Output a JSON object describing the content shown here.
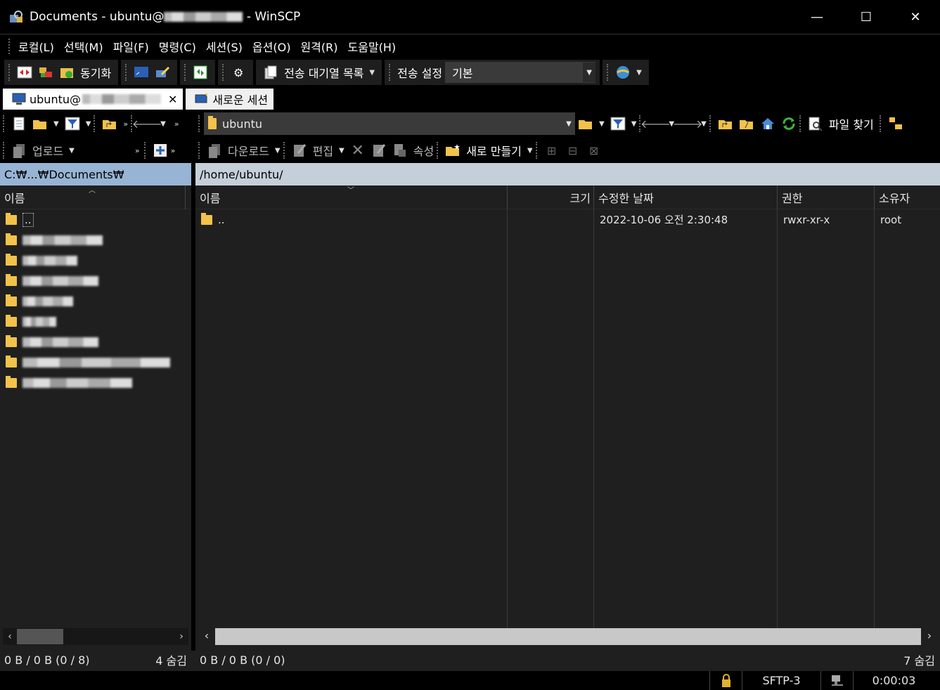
{
  "window": {
    "title_prefix": "Documents - ubuntu@",
    "title_suffix": " - WinSCP",
    "minimize": "—",
    "maximize": "☐",
    "close": "✕"
  },
  "menu": [
    "로컬(L)",
    "선택(M)",
    "파일(F)",
    "명령(C)",
    "세션(S)",
    "옵션(O)",
    "원격(R)",
    "도움말(H)"
  ],
  "toolbar": {
    "sync_label": "동기화",
    "queue_label": "전송 대기열 목록",
    "transfer_settings_label": "전송 설정",
    "transfer_preset_value": "기본"
  },
  "tabs": {
    "session_label": "ubuntu@",
    "new_session_label": "새로운 세션"
  },
  "left_panel": {
    "upload_label": "업로드",
    "path": "C:₩...₩Documents₩",
    "column_name": "이름",
    "entries": [
      {
        "name": ".."
      },
      {
        "name": ""
      },
      {
        "name": ""
      },
      {
        "name": ""
      },
      {
        "name": ""
      },
      {
        "name": ""
      },
      {
        "name": ""
      },
      {
        "name": ""
      },
      {
        "name": ""
      }
    ],
    "status_left": "0 B / 0 B (0 / 8)",
    "status_right": "4 숨김"
  },
  "right_panel": {
    "location_combo": "ubuntu",
    "find_files_label": "파일 찾기",
    "download_label": "다운로드",
    "edit_label": "편집",
    "properties_label": "속성",
    "new_label": "새로 만들기",
    "path": "/home/ubuntu/",
    "columns": {
      "name": "이름",
      "size": "크기",
      "modified": "수정한 날짜",
      "rights": "권한",
      "owner": "소유자"
    },
    "rows": [
      {
        "name": "..",
        "size": "",
        "modified": "2022-10-06 오전 2:30:48",
        "rights": "rwxr-xr-x",
        "owner": "root"
      }
    ],
    "status_left": "0 B / 0 B (0 / 0)",
    "status_right": "7 숨김"
  },
  "statusbar": {
    "protocol": "SFTP-3",
    "elapsed": "0:00:03"
  },
  "colors": {
    "left_path_bg": "#98b4d4",
    "right_path_bg": "#c5cfd9",
    "folder": "#f2c24a"
  }
}
